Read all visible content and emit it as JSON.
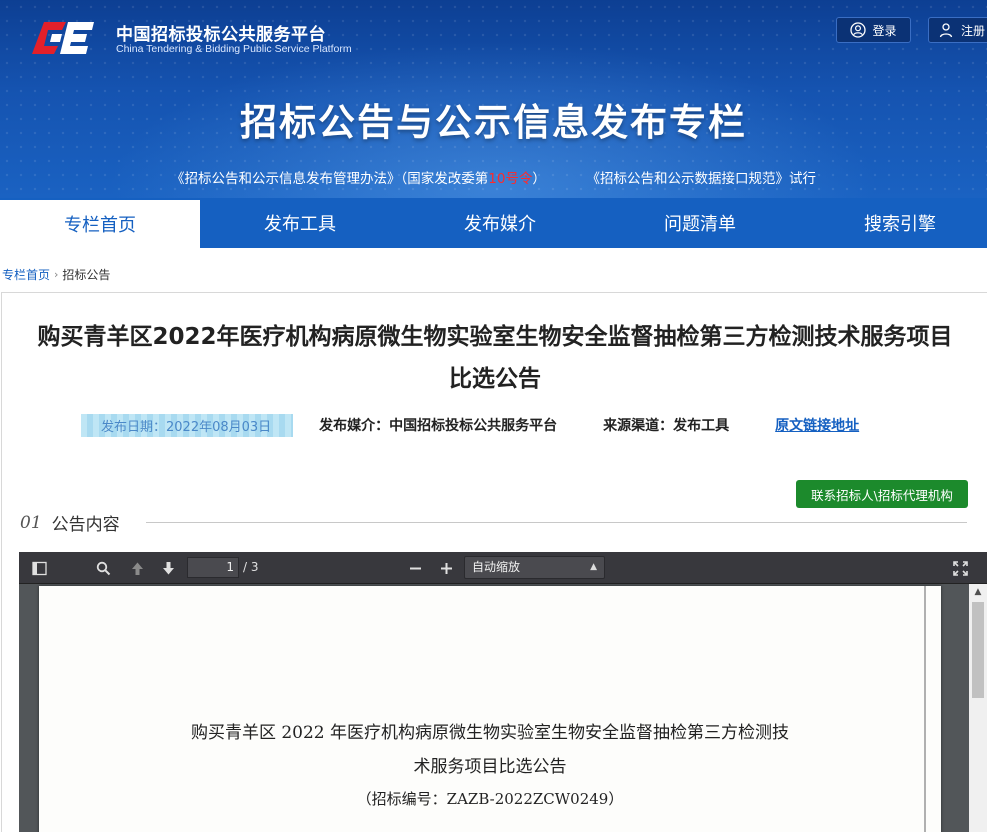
{
  "header": {
    "site_name_cn": "中国招标投标公共服务平台",
    "site_name_en": "China Tendering & Bidding Public Service Platform",
    "login_label": "登录",
    "register_label": "注册",
    "banner_title": "招标公告与公示信息发布专栏",
    "regulation_prefix": "《招标公告和公示信息发布管理办法》（国家发改委第",
    "regulation_num": "10号令",
    "regulation_suffix": "）",
    "regulation2": "《招标公告和公示数据接口规范》试行",
    "accent_color": "#1560c1",
    "highlight_color": "#ff2a2a"
  },
  "nav": {
    "items": [
      {
        "label": "专栏首页"
      },
      {
        "label": "发布工具"
      },
      {
        "label": "发布媒介"
      },
      {
        "label": "问题清单"
      },
      {
        "label": "搜索引擎"
      }
    ]
  },
  "breadcrumb": {
    "home": "专栏首页",
    "current": "招标公告"
  },
  "article": {
    "title_line1": "购买青羊区2022年医疗机构病原微生物实验室生物安全监督抽检第三方检测技术服务项目",
    "title_line2": "比选公告",
    "publish_date": "发布日期：2022年08月03日",
    "media": "发布媒介：中国招标投标公共服务平台",
    "source": "来源渠道：发布工具",
    "original_link": "原文链接地址",
    "contact_button": "联系招标人\\招标代理机构",
    "contact_color": "#1c8a2c",
    "section_num": "01",
    "section_label": "公告内容"
  },
  "viewer": {
    "current_page": "1",
    "total_pages": "/ 3",
    "zoom": "自动缩放",
    "icons": [
      "sidebar-toggle-icon",
      "search-icon",
      "previous-page-icon",
      "next-page-icon",
      "zoom-out-icon",
      "zoom-in-icon",
      "fullscreen-icon"
    ],
    "doc_line1": "购买青羊区 2022 年医疗机构病原微生物实验室生物安全监督抽检第三方检测技",
    "doc_line2": "术服务项目比选公告",
    "doc_line3": "（招标编号：ZAZB-2022ZCW0249）"
  }
}
